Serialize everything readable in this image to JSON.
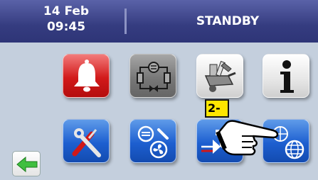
{
  "header": {
    "date": "14 Feb",
    "time": "09:45",
    "status": "STANDBY"
  },
  "tiles": [
    {
      "name": "alarm-button",
      "icon": "bell-icon",
      "color": "#d21a1a"
    },
    {
      "name": "refrigeration-circuit-button",
      "icon": "refrigeration-circuit-icon",
      "color": "#787878"
    },
    {
      "name": "service-tools-button",
      "icon": "wheelbarrow-tools-icon",
      "color": "#e6e6e6"
    },
    {
      "name": "info-button",
      "icon": "info-icon",
      "color": "#e6e6e6"
    },
    {
      "name": "settings-button",
      "icon": "wrench-screwdriver-icon",
      "color": "#1d5fd0"
    },
    {
      "name": "compressor-fan-settings-button",
      "icon": "compressor-fan-wrench-icon",
      "color": "#1d5fd0"
    },
    {
      "name": "valve-settings-button",
      "icon": "valve-icon",
      "color": "#1d5fd0"
    },
    {
      "name": "network-settings-button",
      "icon": "globe-icon",
      "color": "#1d5fd0"
    }
  ],
  "nav": {
    "back_icon": "arrow-left-icon",
    "back_color": "#3fbf3f"
  },
  "overlay": {
    "step_label": "2-",
    "pointer_icon": "pointing-hand-icon"
  }
}
